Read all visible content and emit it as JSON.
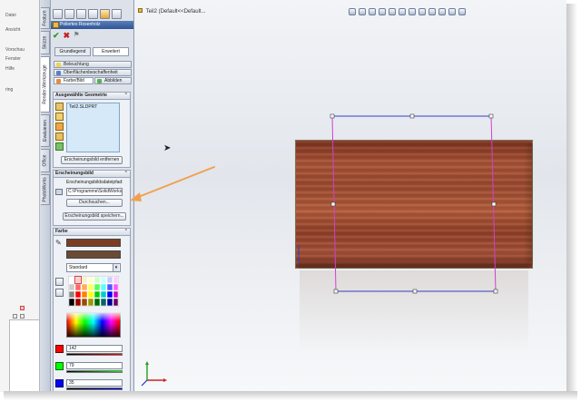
{
  "left_window": {
    "items": [
      "Datei",
      "Ansicht",
      "Vorschau",
      "Fenster",
      "Hilfe",
      "ring"
    ]
  },
  "vertical_tabs": [
    "Feature",
    "Skizze",
    "Render-Werkzeuge",
    "Evaluieren",
    "Office",
    "PhotoWorks"
  ],
  "property_manager": {
    "title": "Poliertes Rosenholz",
    "subtabs": [
      "Grundlegend",
      "Erweitert"
    ],
    "active_subtab": "Erweitert",
    "prop_tabs": {
      "lighting": "Beleuchtung",
      "surface": "Oberflächenbeschaffenheit",
      "color": "Farbe/Bild",
      "mapping": "Abbilden"
    },
    "geometry": {
      "header": "Ausgewählte Geometrie",
      "list_item": "Teil2.SLDPRT",
      "remove_button": "Erscheinungsbild entfernen"
    },
    "appearance": {
      "header": "Erscheinungsbild",
      "path_label": "Erscheinungsbildsdateipfad:",
      "path_value": "C:\\Programme\\SolidWorks",
      "browse_button": "Durchsuchen...",
      "save_button": "Erscheinungsbild speichern..."
    },
    "color": {
      "header": "Farbe",
      "mode": "Standard",
      "red_value": "142",
      "green_value": "79",
      "blue_value": "35",
      "swatch_top": "#7b3d24",
      "swatch_bottom": "#6b4a34"
    }
  },
  "graphics": {
    "doc_title": "Teil2  (Default<<Default..."
  },
  "colors": {
    "panel_bg": "#dde2ea",
    "title_blue": "#2f5597",
    "selection_magenta": "#d040d0",
    "selection_blue": "#3040c0",
    "arrow_orange": "#f0a050",
    "wood": "#a5523a"
  }
}
